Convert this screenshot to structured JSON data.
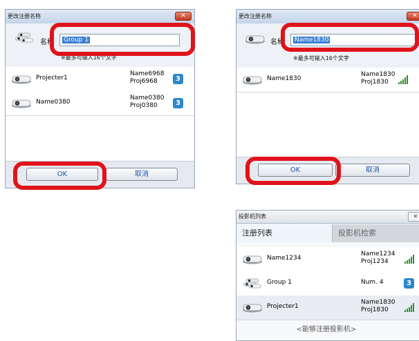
{
  "dialog_left": {
    "title": "更改注册名称",
    "name_label": "名称",
    "name_value": "Group 1",
    "hint": "※最多可输入16个文字",
    "rows": [
      {
        "name": "Projecter1",
        "sub1": "Name6968",
        "sub2": "Proj6968",
        "badge": "3"
      },
      {
        "name": "Name0380",
        "sub1": "Name0380",
        "sub2": "Proj0380",
        "badge": "3"
      }
    ],
    "ok_label": "OK",
    "cancel_label": "取消"
  },
  "dialog_right": {
    "title": "更改注册名称",
    "name_label": "名称",
    "name_value": "Name1830",
    "hint": "※最多可输入16个文字",
    "rows": [
      {
        "name": "Name1830",
        "sub1": "Name1830",
        "sub2": "Proj1830"
      }
    ],
    "ok_label": "OK",
    "cancel_label": "取消"
  },
  "projector_list": {
    "title": "投影机列表",
    "tab_registered": "注册列表",
    "tab_search": "投影机检索",
    "rows": [
      {
        "name": "Name1234",
        "sub1": "Name1234",
        "sub2": "Proj1234"
      },
      {
        "name": "Group 1",
        "sub1": "Num. 4",
        "badge": "3"
      },
      {
        "name": "Projecter1",
        "sub1": "Name1830",
        "sub2": "Proj1830"
      }
    ],
    "footer_text": "<能够注册投影机>"
  },
  "colors": {
    "highlight": "#e0131a",
    "badge": "#2f87c8",
    "selection": "#3c7fd1"
  },
  "icons": [
    "projector-icon",
    "group-projector-icon",
    "signal-icon",
    "close-icon"
  ]
}
